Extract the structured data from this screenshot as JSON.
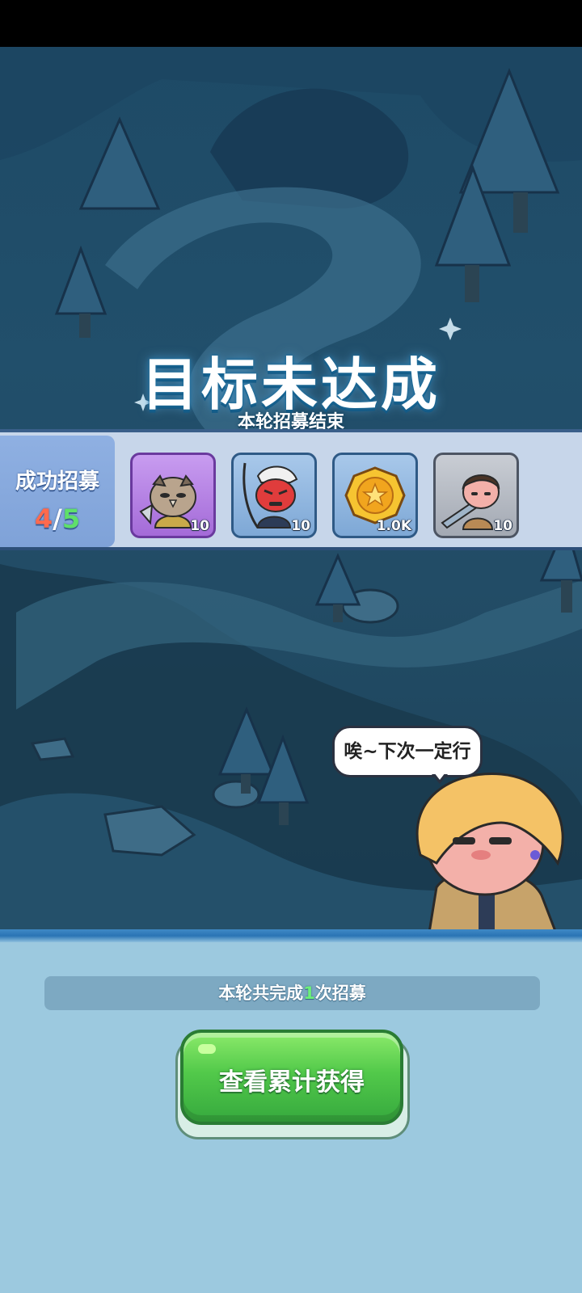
{
  "result": {
    "title": "目标未达成",
    "subtitle": "本轮招募结束"
  },
  "recruit": {
    "label": "成功招募",
    "current": "4",
    "separator": "/",
    "total": "5",
    "rewards": [
      {
        "name": "owl-warrior-hero-icon",
        "rarity": "purple",
        "qty": "10"
      },
      {
        "name": "red-demon-samurai-hero-icon",
        "rarity": "blue",
        "qty": "10"
      },
      {
        "name": "gold-coin-icon",
        "rarity": "blue",
        "qty": "1.0K"
      },
      {
        "name": "swordsman-hero-icon",
        "rarity": "gray",
        "qty": "10"
      }
    ]
  },
  "speech": {
    "text": "唉~下次一定行"
  },
  "summary": {
    "prefix": "本轮共完成",
    "count": "1",
    "suffix": "次招募"
  },
  "button": {
    "label": "查看累计获得"
  },
  "colors": {
    "current_count": "#ff6a4d",
    "total_count": "#5fe06a",
    "button_green": "#52c94a",
    "band_bg": "#c7d6ea"
  }
}
